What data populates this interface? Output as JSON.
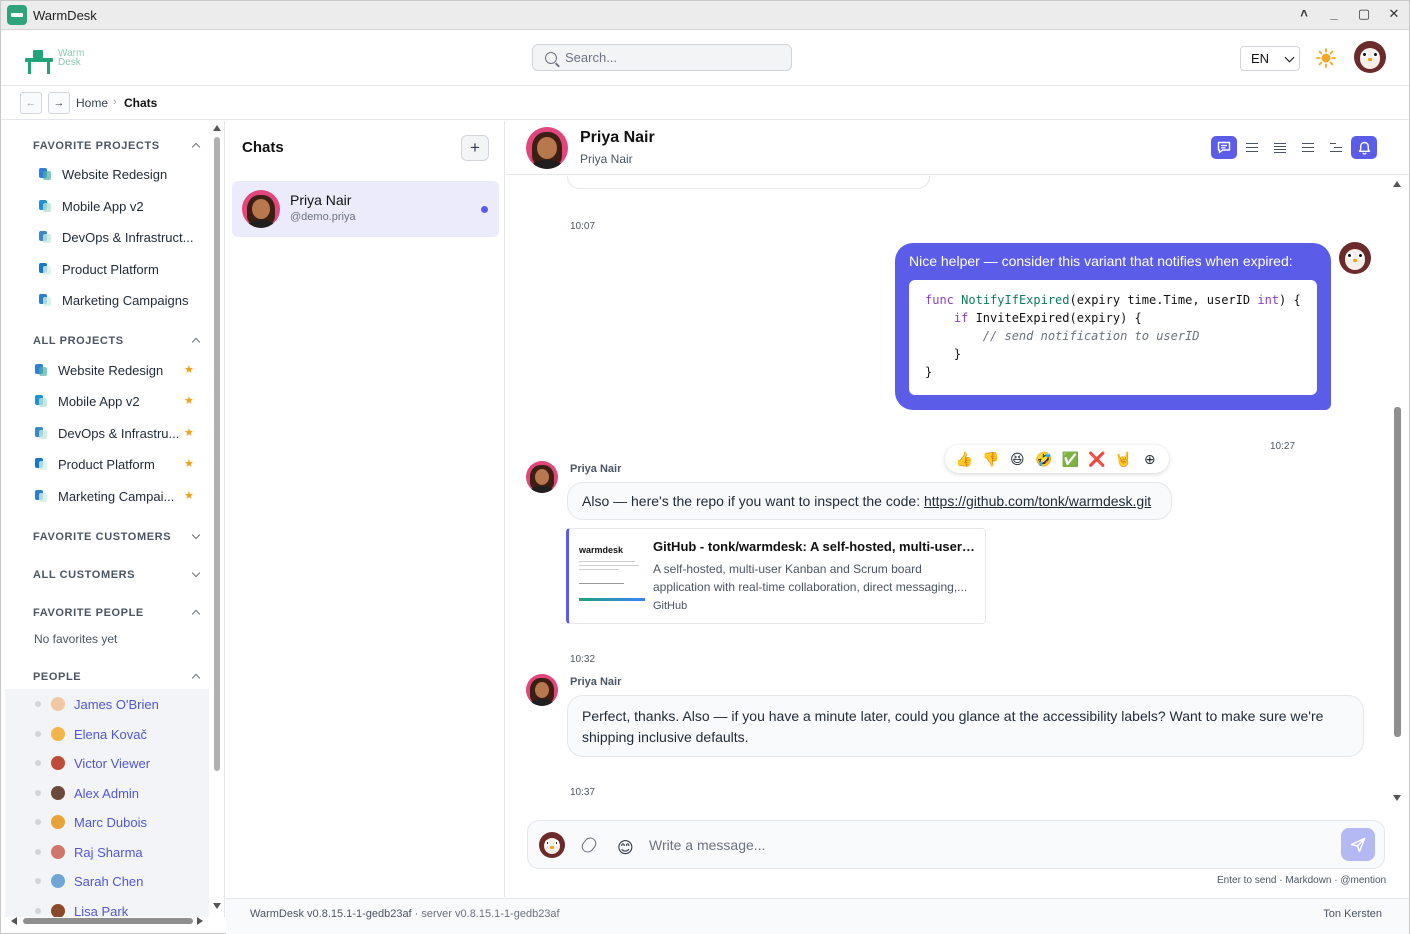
{
  "window": {
    "title": "WarmDesk",
    "controls": [
      "˄",
      "_",
      "▢",
      "✕"
    ]
  },
  "logo": {
    "line1": "Warm",
    "line2": "Desk"
  },
  "search": {
    "placeholder": "Search..."
  },
  "language": {
    "selected": "EN"
  },
  "breadcrumb": {
    "back": "←",
    "forward": "→",
    "home": "Home",
    "separator": "›",
    "current": "Chats"
  },
  "sidebar": {
    "favorite_projects": {
      "title": "FAVORITE PROJECTS",
      "items": [
        {
          "label": "Website Redesign",
          "colors": [
            "#2d7fd8",
            "#4fb0a0"
          ]
        },
        {
          "label": "Mobile App v2",
          "colors": [
            "#1c92d2",
            "#b9e2d7"
          ]
        },
        {
          "label": "DevOps & Infrastruct...",
          "colors": [
            "#3a88c9",
            "#c6e8dd"
          ]
        },
        {
          "label": "Product Platform",
          "colors": [
            "#1579c7",
            "#d8f0ea"
          ]
        },
        {
          "label": "Marketing Campaigns",
          "colors": [
            "#2b7fca",
            "#d2efe5"
          ]
        }
      ]
    },
    "all_projects": {
      "title": "ALL PROJECTS",
      "items": [
        {
          "label": "Website Redesign",
          "colors": [
            "#2d7fd8",
            "#4fb0a0"
          ]
        },
        {
          "label": "Mobile App v2",
          "colors": [
            "#1c92d2",
            "#b9e2d7"
          ]
        },
        {
          "label": "DevOps & Infrastru...",
          "colors": [
            "#3a88c9",
            "#c6e8dd"
          ]
        },
        {
          "label": "Product Platform",
          "colors": [
            "#1579c7",
            "#d8f0ea"
          ]
        },
        {
          "label": "Marketing Campai...",
          "colors": [
            "#2b7fca",
            "#d2efe5"
          ]
        }
      ],
      "star": "★"
    },
    "favorite_customers": {
      "title": "FAVORITE CUSTOMERS"
    },
    "all_customers": {
      "title": "ALL CUSTOMERS"
    },
    "favorite_people": {
      "title": "FAVORITE PEOPLE",
      "empty": "No favorites yet"
    },
    "people": {
      "title": "PEOPLE",
      "items": [
        {
          "name": "James O'Brien",
          "color": "#f2c7a3"
        },
        {
          "name": "Elena Kovač",
          "color": "#f3b54a"
        },
        {
          "name": "Victor Viewer",
          "color": "#c04a3a"
        },
        {
          "name": "Alex Admin",
          "color": "#6b4a3a"
        },
        {
          "name": "Marc Dubois",
          "color": "#e8a23a"
        },
        {
          "name": "Raj Sharma",
          "color": "#d0776b"
        },
        {
          "name": "Sarah Chen",
          "color": "#6fa6d8"
        },
        {
          "name": "Lisa Park",
          "color": "#8a4a2a"
        }
      ]
    }
  },
  "chats": {
    "title": "Chats",
    "add_label": "+",
    "items": [
      {
        "name": "Priya Nair",
        "handle": "@demo.priya"
      }
    ]
  },
  "conversation": {
    "name": "Priya Nair",
    "subtitle": "Priya Nair",
    "messages": {
      "ts1": "10:07",
      "own_text": "Nice helper — consider this variant that notifies when expired:",
      "ts2": "10:27",
      "sender": "Priya Nair",
      "msg2_text": "Also — here's the repo if you want to inspect the code: ",
      "msg2_link": "https://github.com/tonk/warmdesk.git",
      "reactions": [
        "👍",
        "👎",
        "😆",
        "🤣",
        "✅",
        "❌",
        "🤘",
        "⊕"
      ],
      "preview": {
        "brand": "warmdesk",
        "title": "GitHub - tonk/warmdesk: A self-hosted, multi-user K...",
        "desc1": "A self-hosted, multi-user Kanban and Scrum board",
        "desc2": "application with real-time collaboration, direct messaging,...",
        "site": "GitHub"
      },
      "ts3": "10:32",
      "msg3_line1": "Perfect, thanks. Also — if you have a minute later, could you glance at the accessibility labels? Want to make sure we're",
      "msg3_line2": "shipping inclusive defaults.",
      "ts4": "10:37"
    }
  },
  "composer": {
    "placeholder": "Write a message...",
    "emoji": "😊",
    "hint": "Enter to send · Markdown · @mention"
  },
  "footer": {
    "version": "WarmDesk v0.8.15.1-1-gedb23af",
    "server": " · server v0.8.15.1-1-gedb23af",
    "user": "Ton Kersten"
  }
}
